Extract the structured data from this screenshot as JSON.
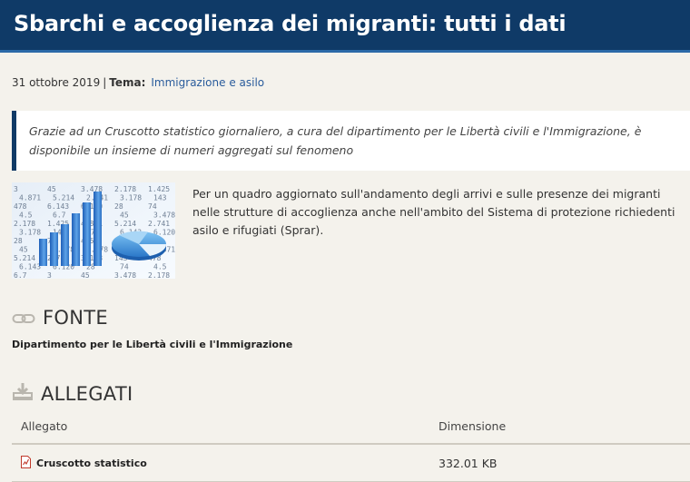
{
  "header": {
    "title": "Sbarchi e accoglienza dei migranti: tutti i dati"
  },
  "meta": {
    "date": "31 ottobre 2019",
    "separator": "|",
    "tema_label": "Tema:",
    "tema_link": "Immigrazione e asilo"
  },
  "quote": "Grazie ad un Cruscotto statistico giornaliero, a cura del dipartimento per le Libertà civili e l'Immigrazione, è disponibile un insieme di numeri aggregati sul fenomeno",
  "intro": "Per un quadro aggiornato sull'andamento degli arrivi e sulle presenze dei migranti nelle strutture di accoglienza anche nell'ambito del Sistema di protezione richiedenti asilo e rifugiati (Sprar).",
  "thumbnail": {
    "icon": "statistics-chart-image",
    "numbers": [
      "3",
      "45",
      "3.478",
      "2.178",
      "1.425",
      "4.871",
      "5.214",
      "2.741",
      "3.178",
      "143",
      "478",
      "6.143",
      "6.120",
      "28",
      "74",
      "4.5",
      "6.7"
    ]
  },
  "fonte": {
    "icon": "link-icon",
    "title": "FONTE",
    "text": "Dipartimento per le Libertà civili e l'Immigrazione"
  },
  "allegati": {
    "icon": "download-icon",
    "title": "ALLEGATI",
    "columns": {
      "file": "Allegato",
      "size": "Dimensione"
    },
    "rows": [
      {
        "icon": "pdf-icon",
        "name": "Cruscotto statistico",
        "size": "332.01 KB"
      }
    ]
  },
  "colors": {
    "header_bg": "#0f3a67",
    "link": "#2a5c9c",
    "accent_border": "#103a66"
  }
}
